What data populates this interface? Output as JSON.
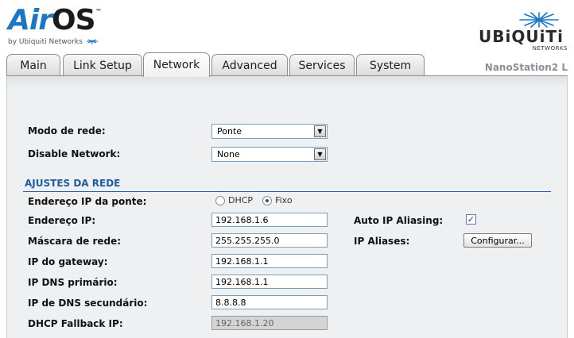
{
  "brand": {
    "product_air": "Air",
    "product_os": "OS",
    "trademark": "™",
    "byline": "by Ubiquiti Networks",
    "company": "UBiQUiTi",
    "company_sub": "NETWORKS"
  },
  "device_name": "NanoStation2 L",
  "tabs": [
    {
      "label": "Main",
      "active": false
    },
    {
      "label": "Link Setup",
      "active": false
    },
    {
      "label": "Network",
      "active": true
    },
    {
      "label": "Advanced",
      "active": false
    },
    {
      "label": "Services",
      "active": false
    },
    {
      "label": "System",
      "active": false
    }
  ],
  "network_mode": {
    "label": "Modo de rede:",
    "value": "Ponte"
  },
  "disable_network": {
    "label": "Disable Network:",
    "value": "None"
  },
  "section_title": "AJUSTES DA REDE",
  "bridge_ip": {
    "label": "Endereço IP da ponte:",
    "options": [
      {
        "label": "DHCP",
        "selected": false
      },
      {
        "label": "Fixo",
        "selected": true
      }
    ]
  },
  "fields": {
    "ip_address": {
      "label": "Endereço IP:",
      "value": "192.168.1.6"
    },
    "netmask": {
      "label": "Máscara de rede:",
      "value": "255.255.255.0"
    },
    "gateway": {
      "label": "IP do gateway:",
      "value": "192.168.1.1"
    },
    "dns_primary": {
      "label": "IP DNS primário:",
      "value": "192.168.1.1"
    },
    "dns_secondary": {
      "label": "IP de DNS secundário:",
      "value": "8.8.8.8"
    },
    "dhcp_fallback": {
      "label": "DHCP Fallback IP:",
      "value": "192.168.1.20"
    }
  },
  "auto_ip_aliasing": {
    "label": "Auto IP Aliasing:",
    "checked": true,
    "check_glyph": "✓"
  },
  "ip_aliases": {
    "label": "IP Aliases:",
    "button": "Configurar..."
  },
  "colors": {
    "accent": "#1f5da3",
    "panel": "#eef0f2",
    "brand_blue": "#1b77c5"
  }
}
